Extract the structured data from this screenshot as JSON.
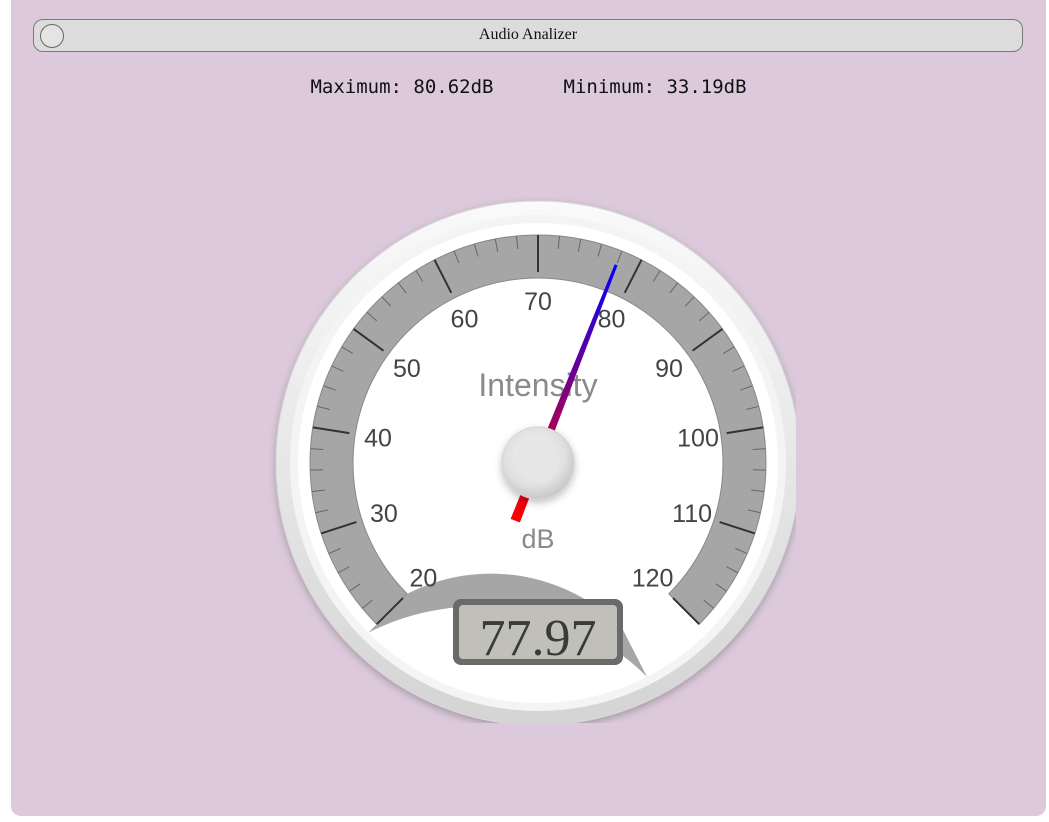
{
  "window": {
    "title": "Audio Analizer"
  },
  "stats": {
    "maximum_label": "Maximum:",
    "maximum_value": "80.62dB",
    "minimum_label": "Minimum:",
    "minimum_value": "33.19dB"
  },
  "gauge": {
    "title": "Intensity",
    "units": "dB",
    "min": 20,
    "max": 120,
    "major_ticks": [
      "20",
      "30",
      "40",
      "50",
      "60",
      "70",
      "80",
      "90",
      "100",
      "110",
      "120"
    ],
    "value": 77.97,
    "value_display": "77.97",
    "colors": {
      "band": "#a6a6a6",
      "needle_start": "#ff0000",
      "needle_end": "#0000ff",
      "face": "#ffffff",
      "lcd_bg": "#c0c0b8"
    }
  }
}
